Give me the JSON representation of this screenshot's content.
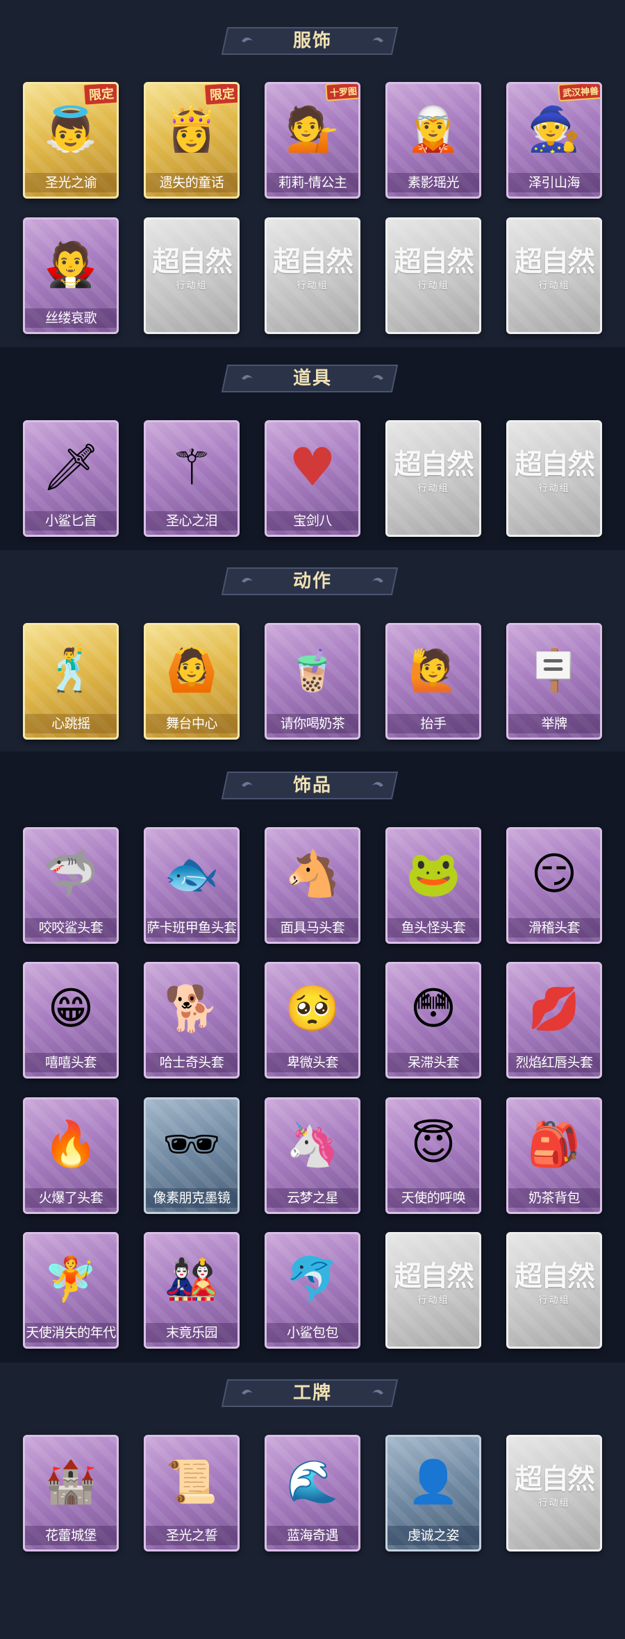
{
  "sections": [
    {
      "title": "服饰",
      "items": [
        {
          "label": "圣光之谕",
          "icon": "angel-girl-portrait-icon",
          "rarity": "gold",
          "badge": "限定"
        },
        {
          "label": "遗失的童话",
          "icon": "fairytale-girl-portrait-icon",
          "rarity": "gold",
          "badge": "限定"
        },
        {
          "label": "莉莉-情公主",
          "icon": "pink-hair-princess-portrait-icon",
          "rarity": "purple",
          "badge": "十罗图"
        },
        {
          "label": "素影瑶光",
          "icon": "silver-hair-girl-portrait-icon",
          "rarity": "purple"
        },
        {
          "label": "泽引山海",
          "icon": "silver-hair-boy-portrait-icon",
          "rarity": "purple",
          "badge": "武汉神兽"
        },
        {
          "label": "丝缕哀歌",
          "icon": "gothic-girl-portrait-icon",
          "rarity": "purple"
        },
        {
          "label": "",
          "icon": "empty-slot-icon",
          "rarity": "empty"
        },
        {
          "label": "",
          "icon": "empty-slot-icon",
          "rarity": "empty"
        },
        {
          "label": "",
          "icon": "empty-slot-icon",
          "rarity": "empty"
        },
        {
          "label": "",
          "icon": "empty-slot-icon",
          "rarity": "empty"
        }
      ]
    },
    {
      "title": "道具",
      "items": [
        {
          "label": "小鲨匕首",
          "icon": "shark-dagger-icon",
          "rarity": "purple"
        },
        {
          "label": "圣心之泪",
          "icon": "heart-scepter-icon",
          "rarity": "purple"
        },
        {
          "label": "宝剑八",
          "icon": "heart-badge-icon",
          "rarity": "purple"
        },
        {
          "label": "",
          "icon": "empty-slot-icon",
          "rarity": "empty"
        },
        {
          "label": "",
          "icon": "empty-slot-icon",
          "rarity": "empty"
        }
      ]
    },
    {
      "title": "动作",
      "items": [
        {
          "label": "心跳摇",
          "icon": "heartbeat-dance-icon",
          "rarity": "gold"
        },
        {
          "label": "舞台中心",
          "icon": "center-stage-pose-icon",
          "rarity": "gold"
        },
        {
          "label": "请你喝奶茶",
          "icon": "milk-tea-gesture-icon",
          "rarity": "purple"
        },
        {
          "label": "抬手",
          "icon": "raise-hand-icon",
          "rarity": "purple"
        },
        {
          "label": "举牌",
          "icon": "hold-sign-icon",
          "rarity": "purple"
        }
      ]
    },
    {
      "title": "饰品",
      "items": [
        {
          "label": "咬咬鲨头套",
          "icon": "shark-mask-icon",
          "rarity": "purple"
        },
        {
          "label": "萨卡班甲鱼头套",
          "icon": "fish-head-mask-icon",
          "rarity": "purple"
        },
        {
          "label": "面具马头套",
          "icon": "horse-mask-icon",
          "rarity": "purple"
        },
        {
          "label": "鱼头怪头套",
          "icon": "fish-monster-mask-icon",
          "rarity": "purple"
        },
        {
          "label": "滑稽头套",
          "icon": "funny-face-mask-icon",
          "rarity": "purple"
        },
        {
          "label": "嘻嘻头套",
          "icon": "grin-emoji-mask-icon",
          "rarity": "purple"
        },
        {
          "label": "哈士奇头套",
          "icon": "husky-mask-icon",
          "rarity": "purple"
        },
        {
          "label": "卑微头套",
          "icon": "humble-emoji-mask-icon",
          "rarity": "purple"
        },
        {
          "label": "呆滞头套",
          "icon": "dazed-emoji-mask-icon",
          "rarity": "purple"
        },
        {
          "label": "烈焰红唇头套",
          "icon": "red-lips-mask-icon",
          "rarity": "purple"
        },
        {
          "label": "火爆了头套",
          "icon": "fire-mask-icon",
          "rarity": "purple"
        },
        {
          "label": "像素朋克墨镜",
          "icon": "pixel-sunglasses-icon",
          "rarity": "blue"
        },
        {
          "label": "云梦之星",
          "icon": "unicorn-star-icon",
          "rarity": "purple"
        },
        {
          "label": "天使的呼唤",
          "icon": "angel-doll-icon",
          "rarity": "purple"
        },
        {
          "label": "奶茶背包",
          "icon": "milk-tea-backpack-icon",
          "rarity": "purple"
        },
        {
          "label": "天使消失的年代",
          "icon": "angel-girl-doll-icon",
          "rarity": "purple"
        },
        {
          "label": "末竟乐园",
          "icon": "pink-doll-icon",
          "rarity": "purple"
        },
        {
          "label": "小鲨包包",
          "icon": "shark-bag-icon",
          "rarity": "purple"
        },
        {
          "label": "",
          "icon": "empty-slot-icon",
          "rarity": "empty"
        },
        {
          "label": "",
          "icon": "empty-slot-icon",
          "rarity": "empty"
        }
      ]
    },
    {
      "title": "工牌",
      "items": [
        {
          "label": "花蕾城堡",
          "icon": "castle-card-icon",
          "rarity": "purple"
        },
        {
          "label": "圣光之誓",
          "icon": "golden-card-icon",
          "rarity": "purple"
        },
        {
          "label": "蓝海奇遇",
          "icon": "blue-sea-card-icon",
          "rarity": "purple"
        },
        {
          "label": "虔诚之姿",
          "icon": "silhouette-card-icon",
          "rarity": "blue"
        },
        {
          "label": "",
          "icon": "empty-slot-icon",
          "rarity": "empty"
        }
      ]
    }
  ],
  "placeholder": {
    "brand": "超自然",
    "sub": "行动组"
  },
  "colors": {
    "background": "#141a27",
    "header": "#2b3348",
    "title": "#f1e2b4",
    "purple_card": "#a77cc0",
    "gold_card": "#e1b94b",
    "empty_card": "#c9c9c9"
  }
}
